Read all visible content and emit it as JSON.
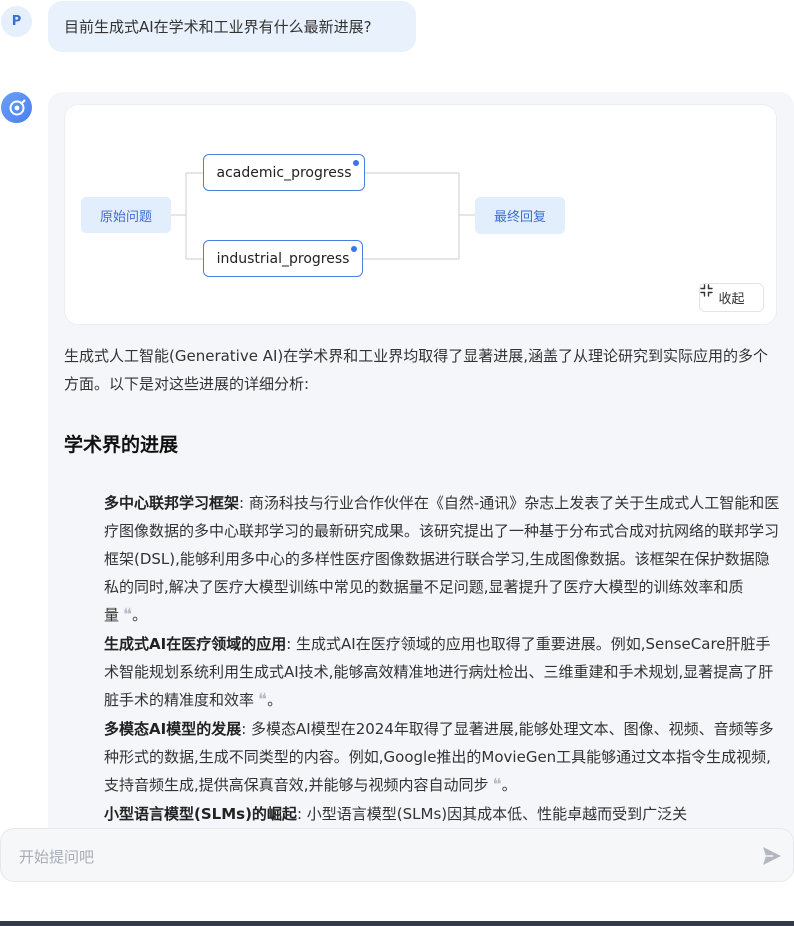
{
  "user": {
    "avatar_letter": "P",
    "question": "目前生成式AI在学术和工业界有什么最新进展?"
  },
  "assistant": {
    "flow": {
      "start_node": "原始问题",
      "branch_nodes": [
        "academic_progress",
        "industrial_progress"
      ],
      "end_node": "最终回复",
      "collapse_label": "收起"
    },
    "intro": "生成式人工智能(Generative AI)在学术界和工业界均取得了显著进展,涵盖了从理论研究到实际应用的多个方面。以下是对这些进展的详细分析:",
    "section_heading": "学术界的进展",
    "items": [
      {
        "title": "多中心联邦学习框架",
        "sep": ": ",
        "text": "商汤科技与行业合作伙伴在《自然-通讯》杂志上发表了关于生成式人工智能和医疗图像数据的多中心联邦学习的最新研究成果。该研究提出了一种基于分布式合成对抗网络的联邦学习框架(DSL),能够利用多中心的多样性医疗图像数据进行联合学习,生成图像数据。该框架在保护数据隐私的同时,解决了医疗大模型训练中常见的数据量不足问题,显著提升了医疗大模型的训练效率和质量",
        "end": "。"
      },
      {
        "title": "生成式AI在医疗领域的应用",
        "sep": ": ",
        "text": "生成式AI在医疗领域的应用也取得了重要进展。例如,SenseCare肝脏手术智能规划系统利用生成式AI技术,能够高效精准地进行病灶检出、三维重建和手术规划,显著提高了肝脏手术的精准度和效率",
        "end": "。"
      },
      {
        "title": "多模态AI模型的发展",
        "sep": ": ",
        "text": "多模态AI模型在2024年取得了显著进展,能够处理文本、图像、视频、音频等多种形式的数据,生成不同类型的内容。例如,Google推出的MovieGen工具能够通过文本指令生成视频,支持音频生成,提供高保真音效,并能够与视频内容自动同步",
        "end": "。"
      },
      {
        "title": "小型语言模型(SLMs)的崛起",
        "sep": ": ",
        "text": "小型语言模型(SLMs)因其成本低、性能卓越而受到广泛关",
        "end": ""
      }
    ]
  },
  "input": {
    "placeholder": "开始提问吧"
  },
  "colors": {
    "accent": "#3a76e6",
    "node_fill": "#e3eefc",
    "panel_bg": "#f4f6fa"
  }
}
